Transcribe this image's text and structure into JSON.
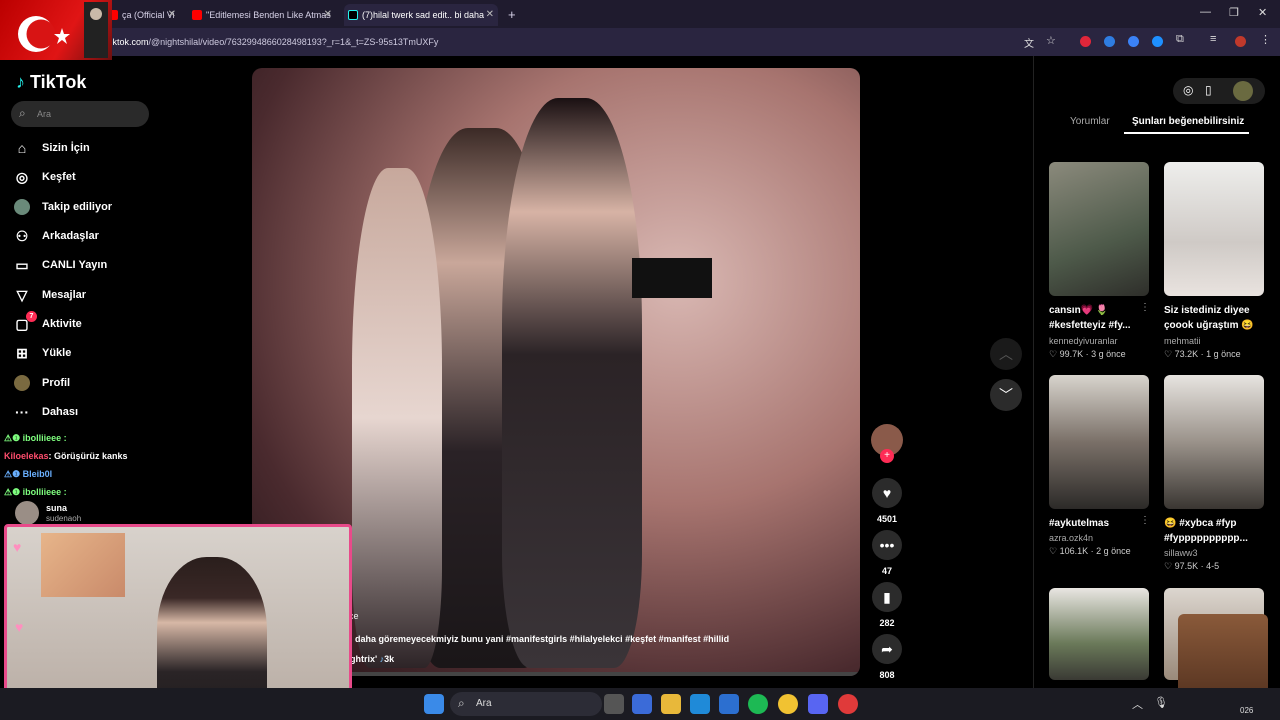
{
  "browser": {
    "tabs": [
      {
        "label": "ça (Official Vi"
      },
      {
        "label": "\"Editlemesi Benden Like Atmas"
      },
      {
        "label": "(7)hilal twerk sad edit.. bi daha"
      }
    ],
    "new_tab": "+",
    "url_host": "tiktok.com",
    "url_path": "/@nightshilal/video/7632994866028498193?_r=1&_t=ZS-95s13TmUXFy"
  },
  "sidebar": {
    "logo": "TikTok",
    "search_placeholder": "Ara",
    "items": [
      {
        "label": "Sizin İçin",
        "icon": "home-icon"
      },
      {
        "label": "Keşfet",
        "icon": "compass-icon"
      },
      {
        "label": "Takip ediliyor",
        "icon": "following-avatar-icon"
      },
      {
        "label": "Arkadaşlar",
        "icon": "friends-icon"
      },
      {
        "label": "CANLI Yayın",
        "icon": "live-icon"
      },
      {
        "label": "Mesajlar",
        "icon": "messages-icon"
      },
      {
        "label": "Aktivite",
        "icon": "activity-icon",
        "badge": "7"
      },
      {
        "label": "Yükle",
        "icon": "upload-icon"
      },
      {
        "label": "Profil",
        "icon": "profile-icon"
      },
      {
        "label": "Dahası",
        "icon": "more-icon"
      }
    ],
    "following_user": {
      "name": "suna",
      "handle": "sudenaoh"
    }
  },
  "stream_chat": [
    {
      "user": "ibolliieee :",
      "text": ""
    },
    {
      "user": "Kiloelekas",
      "text": ": Görüşürüz kanks"
    },
    {
      "user": "Bleib0l",
      "text": ""
    },
    {
      "user": "ibolliieee :",
      "text": ""
    }
  ],
  "video": {
    "caption_prefix": "nce",
    "description": "i daha göremeyecekmiyiz bunu yani #manifestgirls #hilalyelekci #keşfet #manifest #hillid",
    "music": "ghtrix'",
    "music_count": "3k"
  },
  "actions": {
    "likes": "4501",
    "comments": "47",
    "saves": "282",
    "shares": "808"
  },
  "right_panel": {
    "tabs": [
      {
        "label": "Yorumlar"
      },
      {
        "label": "Şunları beğenebilirsiniz"
      }
    ],
    "videos": [
      {
        "title": "cansın💗 🌷 #kesfetteyiz #fy...",
        "user": "kennedyivuranlar",
        "views": "99.7K",
        "age": "3 g önce",
        "thumb_color": "#6b6f60"
      },
      {
        "title": "Siz istediniz diyee çoook uğraştım 😆",
        "user": "mehmatii",
        "views": "73.2K",
        "age": "1 g önce",
        "thumb_color": "#d9d6d4"
      },
      {
        "title": "#aykutelmas",
        "user": "azra.ozk4n",
        "views": "106.1K",
        "age": "2 g önce",
        "thumb_color": "#7c7468"
      },
      {
        "title": "😆 #xybca #fyp #fypppppppppp...",
        "user": "sillaww3",
        "views": "97.5K",
        "age": "4-5",
        "thumb_color": "#a8a39c"
      }
    ]
  },
  "taskbar": {
    "search_label": "Ara",
    "year_fragment": "026"
  },
  "colors": {
    "accent": "#fe2c55",
    "tabbar": "#1f1b2e",
    "cam_border": "#e84a8a"
  }
}
